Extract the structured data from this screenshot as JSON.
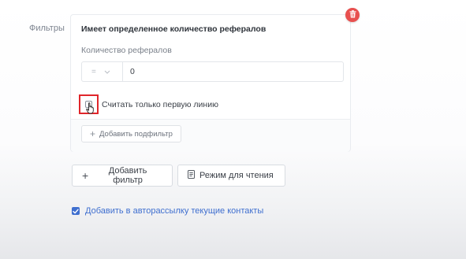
{
  "filters_label": "Фильтры",
  "filter_card": {
    "title": "Имеет определенное количество рефералов",
    "field_label": "Количество рефералов",
    "operator": "=",
    "value": "0",
    "checkbox_label": "Считать только первую линию",
    "checkbox_checked": false,
    "add_subfilter_label": "Добавить подфильтр",
    "delete_icon": "trash-icon"
  },
  "actions": {
    "add_filter_label": "Добавить фильтр",
    "read_mode_label": "Режим для чтения"
  },
  "autosend": {
    "label": "Добавить в авторассылку текущие контакты",
    "checked": true
  },
  "colors": {
    "accent": "#3f6fcf",
    "delete": "#e8504f",
    "highlight": "#e0262b"
  }
}
